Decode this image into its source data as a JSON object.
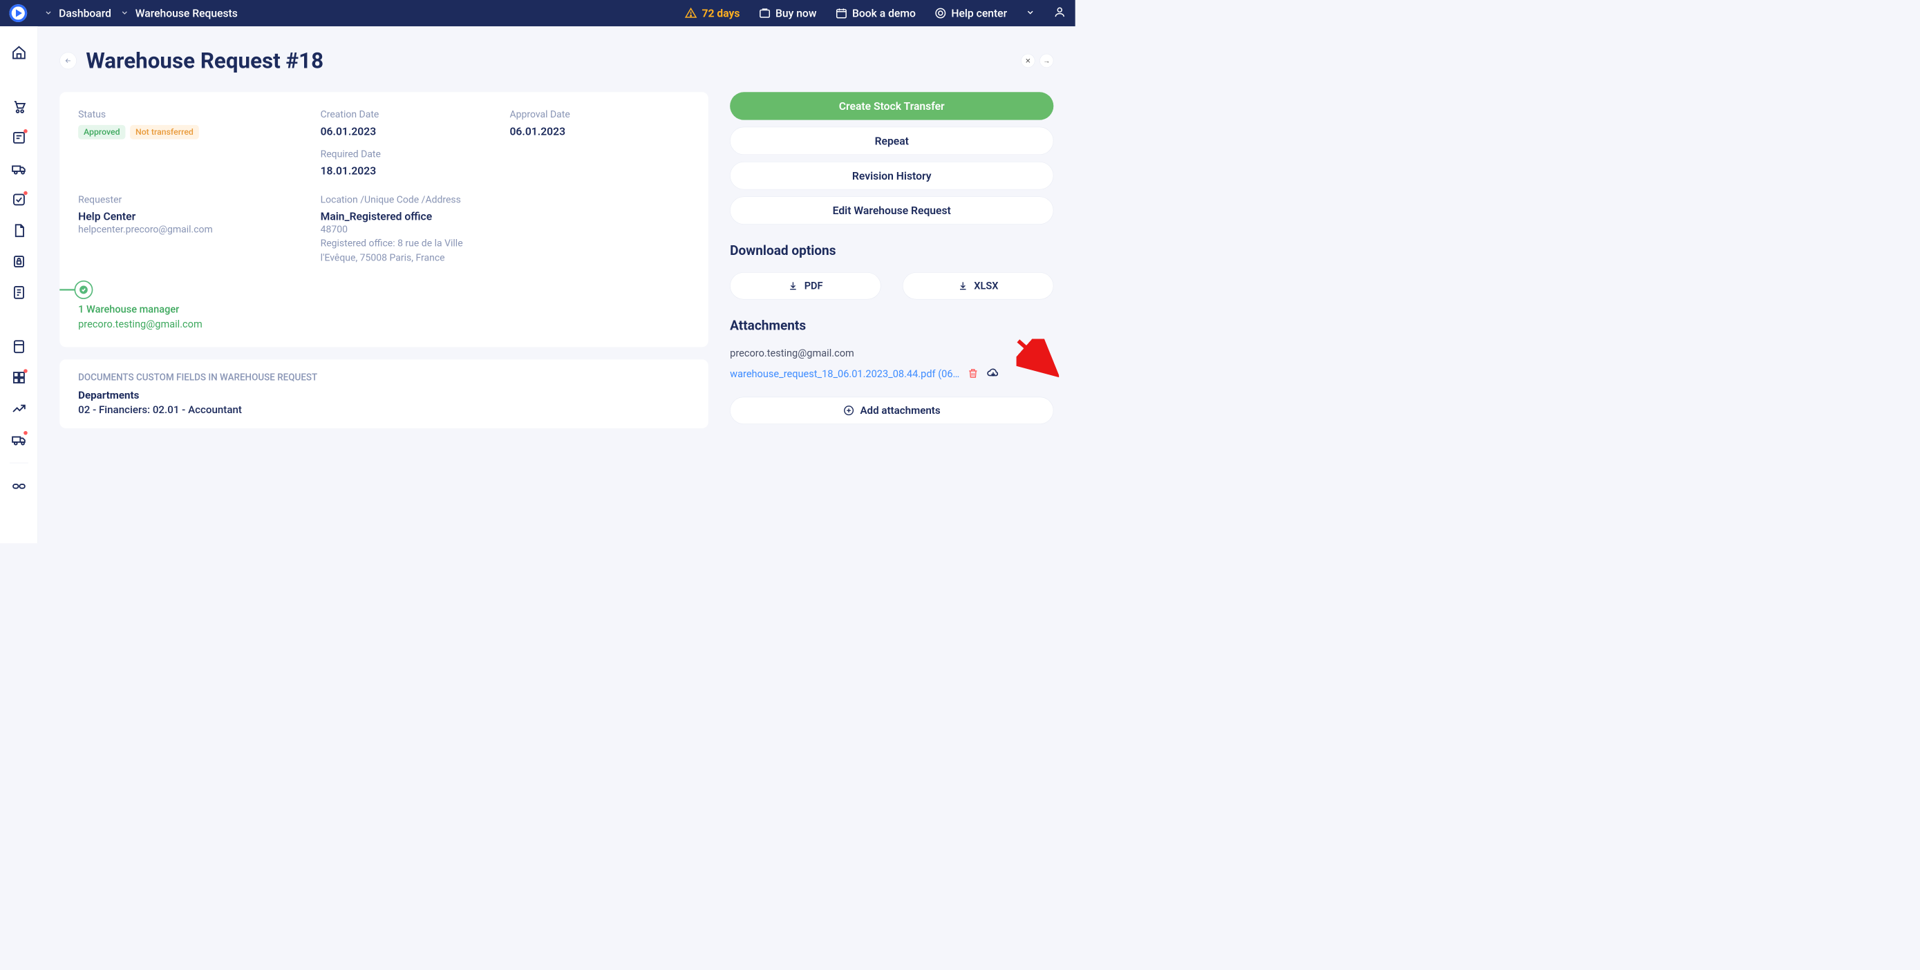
{
  "topbar": {
    "breadcrumbs": [
      "Dashboard",
      "Warehouse Requests"
    ],
    "days_left": "72 days",
    "buy_now": "Buy now",
    "book_demo": "Book a demo",
    "help_center": "Help center"
  },
  "page": {
    "title": "Warehouse Request #18"
  },
  "info": {
    "status_label": "Status",
    "status_approved": "Approved",
    "status_transfer": "Not transferred",
    "creation_date_label": "Creation Date",
    "creation_date": "06.01.2023",
    "required_date_label": "Required Date",
    "required_date": "18.01.2023",
    "approval_date_label": "Approval Date",
    "approval_date": "06.01.2023",
    "requester_label": "Requester",
    "requester_name": "Help Center",
    "requester_email": "helpcenter.precoro@gmail.com",
    "location_label": "Location /Unique Code /Address",
    "location_name": "Main_Registered office",
    "location_code": "48700",
    "location_address": "Registered office: 8 rue de la Ville l'Evêque, 75008 Paris, France"
  },
  "approver": {
    "role": "1 Warehouse manager",
    "email": "precoro.testing@gmail.com"
  },
  "custom_fields": {
    "section": "DOCUMENTS CUSTOM FIELDS IN WAREHOUSE REQUEST",
    "dept_label": "Departments",
    "dept_value": "02 - Financiers: 02.01 - Accountant"
  },
  "actions": {
    "create_transfer": "Create Stock Transfer",
    "repeat": "Repeat",
    "revision_history": "Revision History",
    "edit": "Edit Warehouse Request"
  },
  "download": {
    "heading": "Download options",
    "pdf": "PDF",
    "xlsx": "XLSX"
  },
  "attachments": {
    "heading": "Attachments",
    "uploader": "precoro.testing@gmail.com",
    "file_link": "warehouse_request_18_06.01.2023_08.44.pdf (06…",
    "add_button": "Add attachments"
  }
}
